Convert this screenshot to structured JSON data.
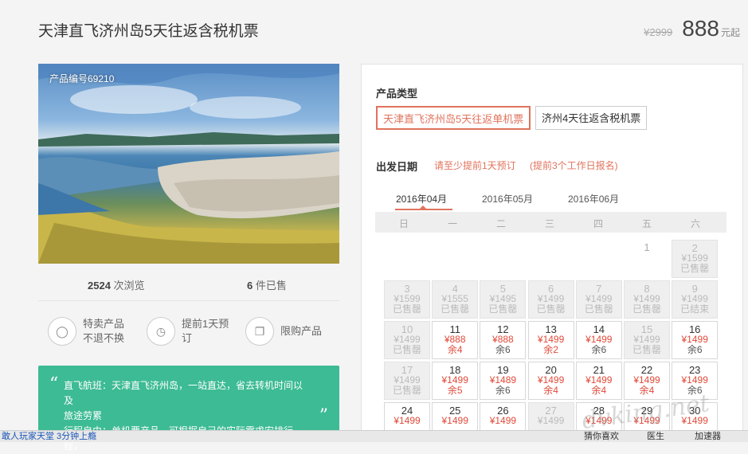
{
  "header": {
    "title": "天津直飞济州岛5天往返含税机票",
    "old_price": "¥2999",
    "price": "888",
    "price_unit": "元起"
  },
  "photo": {
    "product_id": "产品编号69210"
  },
  "stats": {
    "views_count": "2524",
    "views_label": "次浏览",
    "sold_count": "6",
    "sold_label": "件已售"
  },
  "features": [
    {
      "icon": "tag-icon",
      "line1": "特卖产品",
      "line2": "不退不换"
    },
    {
      "icon": "clock-icon",
      "line1": "提前1天预",
      "line2": "订"
    },
    {
      "icon": "copy-icon",
      "line1": "限购产品",
      "line2": ""
    }
  ],
  "intro": {
    "line1": "直飞航班：天津直飞济州岛，一站直达，省去转机时间以及",
    "line2": "旅途劳累",
    "line3": "行程自由：单机票产品，可根据自己的实际需求安排行程，"
  },
  "booking": {
    "type_label": "产品类型",
    "types": [
      {
        "label": "天津直飞济州岛5天往返单机票",
        "selected": true
      },
      {
        "label": "济州4天往返含税机票",
        "selected": false
      }
    ],
    "date_label": "出发日期",
    "note1": "请至少提前1天预订",
    "note2": "(提前3个工作日报名)",
    "months": [
      "2016年04月",
      "2016年05月",
      "2016年06月"
    ],
    "weekdays": [
      "日",
      "一",
      "二",
      "三",
      "四",
      "五",
      "六"
    ]
  },
  "calendar": [
    {
      "day": "1",
      "price": "",
      "remain": "",
      "state": "blank",
      "col": 5,
      "row": 0
    },
    {
      "day": "2",
      "price": "¥1599",
      "remain": "已售罄",
      "state": "past",
      "col": 6,
      "row": 0
    },
    {
      "day": "3",
      "price": "¥1599",
      "remain": "已售罄",
      "state": "past",
      "col": 0,
      "row": 1
    },
    {
      "day": "4",
      "price": "¥1555",
      "remain": "已售罄",
      "state": "past",
      "col": 1,
      "row": 1
    },
    {
      "day": "5",
      "price": "¥1495",
      "remain": "已售罄",
      "state": "past",
      "col": 2,
      "row": 1
    },
    {
      "day": "6",
      "price": "¥1499",
      "remain": "已售罄",
      "state": "past",
      "col": 3,
      "row": 1
    },
    {
      "day": "7",
      "price": "¥1499",
      "remain": "已售罄",
      "state": "past",
      "col": 4,
      "row": 1
    },
    {
      "day": "8",
      "price": "¥1499",
      "remain": "已售罄",
      "state": "past",
      "col": 5,
      "row": 1
    },
    {
      "day": "9",
      "price": "¥1499",
      "remain": "已结束",
      "state": "past",
      "col": 6,
      "row": 1
    },
    {
      "day": "10",
      "price": "¥1499",
      "remain": "已售罄",
      "state": "past",
      "col": 0,
      "row": 2
    },
    {
      "day": "11",
      "price": "¥888",
      "remain": "余4",
      "state": "avail",
      "remain_color": "red",
      "col": 1,
      "row": 2
    },
    {
      "day": "12",
      "price": "¥888",
      "remain": "余6",
      "state": "avail",
      "remain_color": "gray",
      "col": 2,
      "row": 2
    },
    {
      "day": "13",
      "price": "¥1499",
      "remain": "余2",
      "state": "avail",
      "remain_color": "red",
      "col": 3,
      "row": 2
    },
    {
      "day": "14",
      "price": "¥1499",
      "remain": "余6",
      "state": "avail",
      "remain_color": "gray",
      "col": 4,
      "row": 2
    },
    {
      "day": "15",
      "price": "¥1499",
      "remain": "已售罄",
      "state": "past",
      "col": 5,
      "row": 2
    },
    {
      "day": "16",
      "price": "¥1499",
      "remain": "余6",
      "state": "avail",
      "remain_color": "gray",
      "col": 6,
      "row": 2
    },
    {
      "day": "17",
      "price": "¥1499",
      "remain": "已售罄",
      "state": "past",
      "col": 0,
      "row": 3
    },
    {
      "day": "18",
      "price": "¥1499",
      "remain": "余5",
      "state": "avail",
      "remain_color": "red",
      "col": 1,
      "row": 3
    },
    {
      "day": "19",
      "price": "¥1489",
      "remain": "余6",
      "state": "avail",
      "remain_color": "gray",
      "col": 2,
      "row": 3
    },
    {
      "day": "20",
      "price": "¥1499",
      "remain": "余4",
      "state": "avail",
      "remain_color": "red",
      "col": 3,
      "row": 3
    },
    {
      "day": "21",
      "price": "¥1499",
      "remain": "余4",
      "state": "avail",
      "remain_color": "red",
      "col": 4,
      "row": 3
    },
    {
      "day": "22",
      "price": "¥1499",
      "remain": "余4",
      "state": "avail",
      "remain_color": "red",
      "col": 5,
      "row": 3
    },
    {
      "day": "23",
      "price": "¥1499",
      "remain": "余6",
      "state": "avail",
      "remain_color": "gray",
      "col": 6,
      "row": 3
    },
    {
      "day": "24",
      "price": "¥1499",
      "remain": "",
      "state": "avail",
      "remain_color": "red",
      "col": 0,
      "row": 4
    },
    {
      "day": "25",
      "price": "¥1499",
      "remain": "",
      "state": "avail",
      "remain_color": "red",
      "col": 1,
      "row": 4
    },
    {
      "day": "26",
      "price": "¥1499",
      "remain": "",
      "state": "avail",
      "remain_color": "red",
      "col": 2,
      "row": 4
    },
    {
      "day": "27",
      "price": "¥1499",
      "remain": "",
      "state": "past",
      "col": 3,
      "row": 4
    },
    {
      "day": "28",
      "price": "¥1499",
      "remain": "",
      "state": "avail",
      "remain_color": "red",
      "col": 4,
      "row": 4
    },
    {
      "day": "29",
      "price": "¥1499",
      "remain": "",
      "state": "avail",
      "remain_color": "red",
      "col": 5,
      "row": 4
    },
    {
      "day": "30",
      "price": "¥1499",
      "remain": "",
      "state": "avail",
      "remain_color": "red",
      "col": 6,
      "row": 4
    }
  ],
  "taskbar": {
    "left_text": "敢人玩家天堂 3分钟上瘾",
    "item1": "猜你喜欢",
    "item2": "医生",
    "item3": "加速器"
  },
  "watermark": "dvking.net"
}
